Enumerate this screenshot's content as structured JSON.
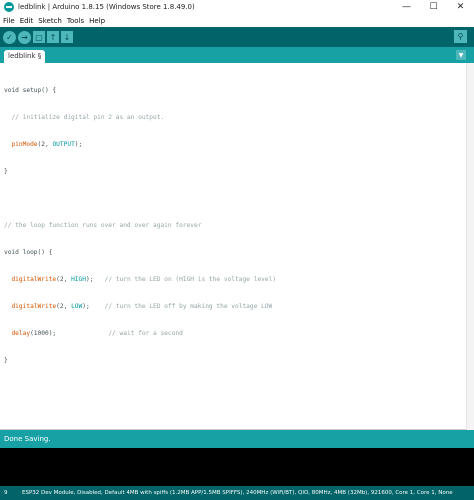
{
  "window": {
    "title": "ledblink | Arduino 1.8.15 (Windows Store 1.8.49.0)",
    "controls": [
      "—",
      "☐",
      "✕"
    ]
  },
  "menu": [
    "File",
    "Edit",
    "Sketch",
    "Tools",
    "Help"
  ],
  "toolbar": {
    "verify_icon": "checkmark-icon",
    "upload_icon": "right-arrow-icon",
    "new_icon": "document-icon",
    "open_icon": "up-arrow-icon",
    "save_icon": "down-arrow-icon",
    "serial_icon": "magnifier-icon"
  },
  "tab": {
    "label": "ledblink §"
  },
  "code": {
    "l1": "void setup() {",
    "l2": "  // initialize digital pin 2 as an output.",
    "l3a": "  pinMode",
    "l3b": "(2, ",
    "l3c": "OUTPUT",
    "l3d": ");",
    "l4": "}",
    "l6": "// the loop function runs over and over again forever",
    "l7": "void loop() {",
    "l8a": "  digitalWrite",
    "l8b": "(2, ",
    "l8c": "HIGH",
    "l8d": ");   ",
    "l8e": "// turn the LED on (HIGH is the voltage level)",
    "l9a": "  digitalWrite",
    "l9b": "(2, ",
    "l9c": "LOW",
    "l9d": ");    ",
    "l9e": "// turn the LED off by making the voltage LOW",
    "l10a": "  delay",
    "l10b": "(1000);              ",
    "l10c": "// wait for a second",
    "l11": "}"
  },
  "console": {
    "status": "Done Saving."
  },
  "statusbar": {
    "line": "9",
    "board": "ESP32 Dev Module, Disabled, Default 4MB with spiffs (1.2MB APP/1.5MB SPIFFS), 240MHz (WiFi/BT), QIO, 80MHz, 4MB (32Mb), 921600, Core 1, Core 1, None"
  },
  "colors": {
    "toolbar_bg": "#006468",
    "tab_strip": "#17a1a5",
    "button": "#4db7bb",
    "keyword_orange": "#d35400",
    "keyword_teal": "#00979c",
    "comment": "#95a5a6"
  }
}
